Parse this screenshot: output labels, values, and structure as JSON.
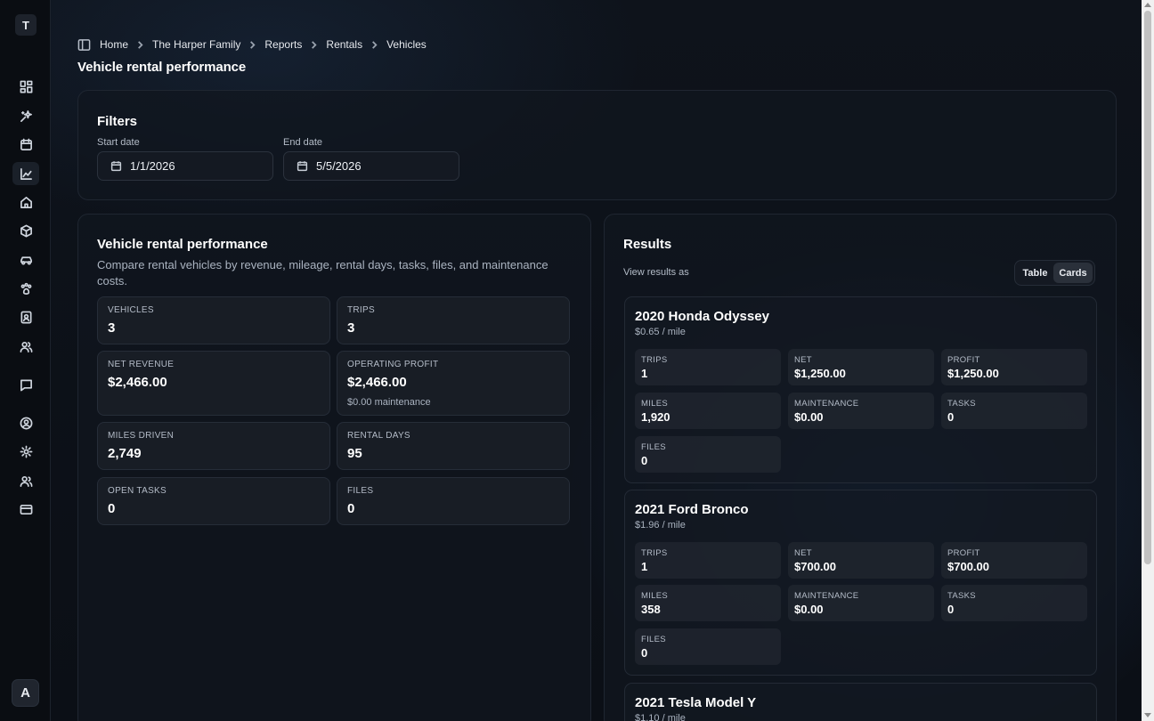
{
  "app": {
    "logo_letter": "T",
    "user_initial": "A"
  },
  "breadcrumb": [
    "Home",
    "The Harper Family",
    "Reports",
    "Rentals",
    "Vehicles"
  ],
  "page_title": "Vehicle rental performance",
  "filters": {
    "title": "Filters",
    "start_label": "Start date",
    "start_value": "1/1/2026",
    "end_label": "End date",
    "end_value": "5/5/2026"
  },
  "performance": {
    "title": "Vehicle rental performance",
    "description": "Compare rental vehicles by revenue, mileage, rental days, tasks, files, and maintenance costs.",
    "stats": [
      {
        "label": "VEHICLES",
        "value": "3"
      },
      {
        "label": "TRIPS",
        "value": "3"
      },
      {
        "label": "NET REVENUE",
        "value": "$2,466.00"
      },
      {
        "label": "OPERATING PROFIT",
        "value": "$2,466.00",
        "sub": "$0.00 maintenance"
      },
      {
        "label": "MILES DRIVEN",
        "value": "2,749"
      },
      {
        "label": "RENTAL DAYS",
        "value": "95"
      },
      {
        "label": "OPEN TASKS",
        "value": "0"
      },
      {
        "label": "FILES",
        "value": "0"
      }
    ]
  },
  "results": {
    "title": "Results",
    "view_label": "View results as",
    "toggle": {
      "table": "Table",
      "cards": "Cards",
      "selected": "Cards"
    },
    "vehicles": [
      {
        "name": "2020 Honda Odyssey",
        "rate": "$0.65 / mile",
        "stats": [
          {
            "label": "TRIPS",
            "value": "1"
          },
          {
            "label": "NET",
            "value": "$1,250.00"
          },
          {
            "label": "PROFIT",
            "value": "$1,250.00"
          },
          {
            "label": "MILES",
            "value": "1,920"
          },
          {
            "label": "MAINTENANCE",
            "value": "$0.00"
          },
          {
            "label": "TASKS",
            "value": "0"
          },
          {
            "label": "FILES",
            "value": "0"
          }
        ]
      },
      {
        "name": "2021 Ford Bronco",
        "rate": "$1.96 / mile",
        "stats": [
          {
            "label": "TRIPS",
            "value": "1"
          },
          {
            "label": "NET",
            "value": "$700.00"
          },
          {
            "label": "PROFIT",
            "value": "$700.00"
          },
          {
            "label": "MILES",
            "value": "358"
          },
          {
            "label": "MAINTENANCE",
            "value": "$0.00"
          },
          {
            "label": "TASKS",
            "value": "0"
          },
          {
            "label": "FILES",
            "value": "0"
          }
        ]
      },
      {
        "name": "2021 Tesla Model Y",
        "rate": "$1.10 / mile"
      }
    ]
  },
  "sidebar": {
    "icons": [
      "dashboard-icon",
      "sparkles-icon",
      "calendar-icon",
      "chart-line-icon",
      "home-icon",
      "package-icon",
      "car-icon",
      "paw-icon",
      "contacts-icon",
      "users-icon",
      "message-icon",
      "user-circle-icon",
      "settings-icon",
      "team-icon",
      "credit-card-icon"
    ],
    "active": "chart-line-icon"
  }
}
